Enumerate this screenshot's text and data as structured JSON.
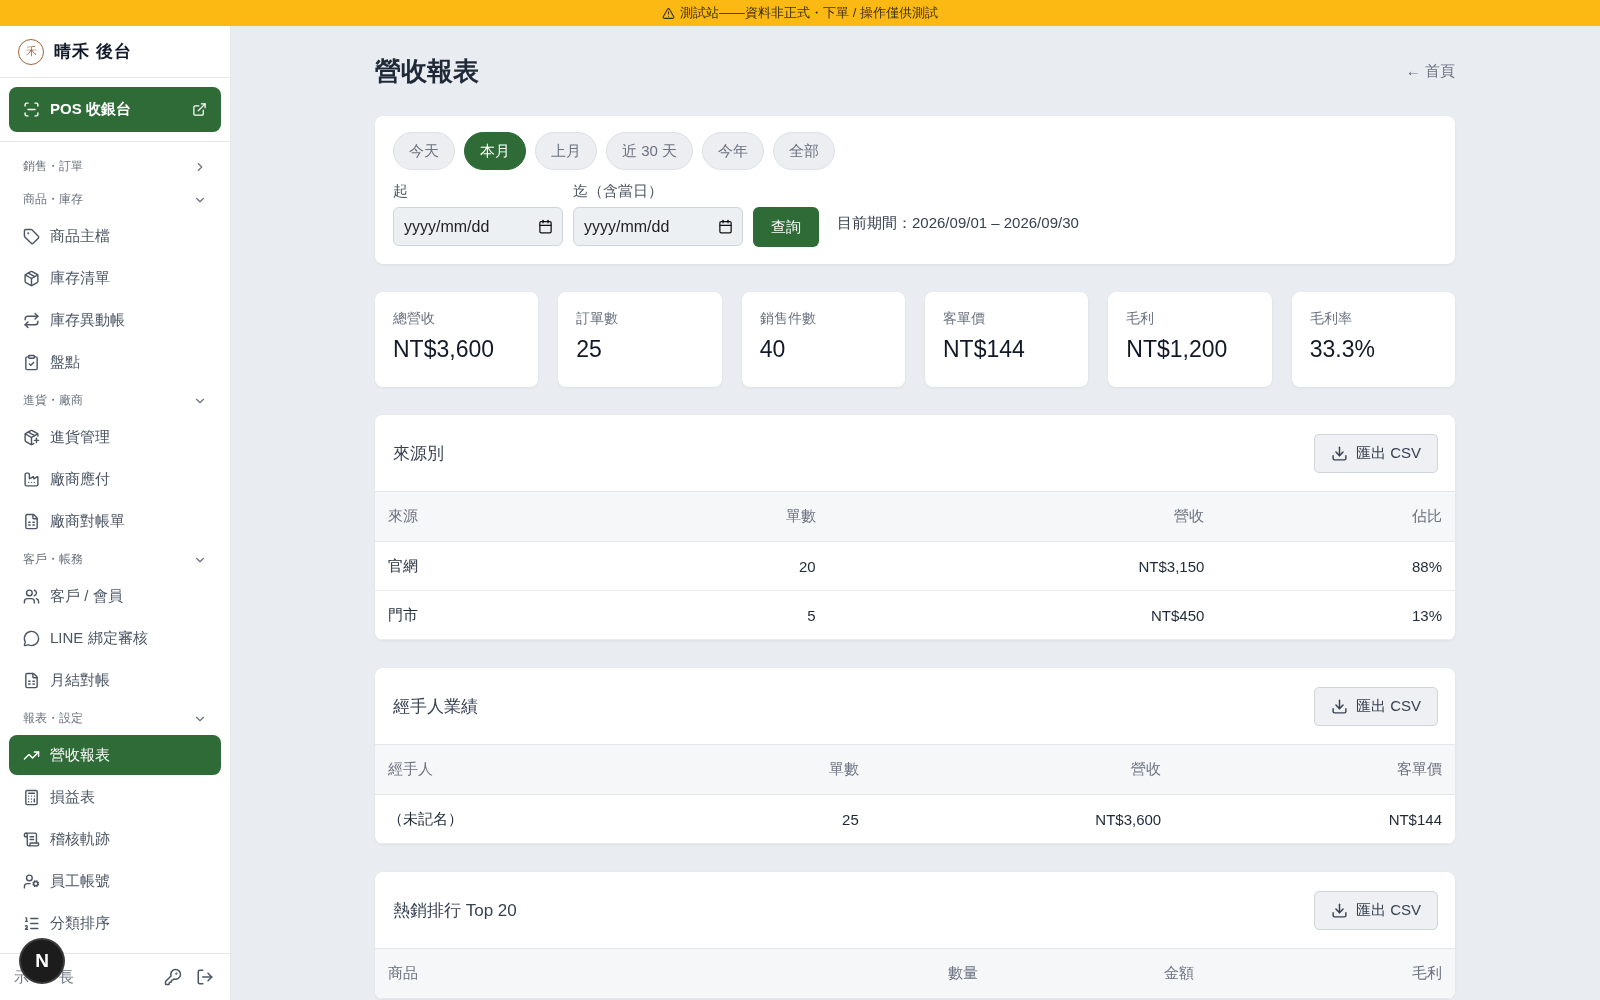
{
  "banner": {
    "text": "測試站——資料非正式・下單 / 操作僅供測試"
  },
  "sidebar": {
    "brand": "晴禾 後台",
    "brand_mark": "禾",
    "pos_button": "POS 收銀台",
    "groups": [
      {
        "label": "銷售・訂單",
        "expanded": false
      },
      {
        "label": "商品・庫存",
        "expanded": true,
        "items": [
          {
            "label": "商品主檔",
            "selected": false
          },
          {
            "label": "庫存清單",
            "selected": false
          },
          {
            "label": "庫存異動帳",
            "selected": false
          },
          {
            "label": "盤點",
            "selected": false
          }
        ]
      },
      {
        "label": "進貨・廠商",
        "expanded": true,
        "items": [
          {
            "label": "進貨管理",
            "selected": false
          },
          {
            "label": "廠商應付",
            "selected": false
          },
          {
            "label": "廠商對帳單",
            "selected": false
          }
        ]
      },
      {
        "label": "客戶・帳務",
        "expanded": true,
        "items": [
          {
            "label": "客戶 / 會員",
            "selected": false
          },
          {
            "label": "LINE 綁定審核",
            "selected": false
          },
          {
            "label": "月結對帳",
            "selected": false
          }
        ]
      },
      {
        "label": "報表・設定",
        "expanded": true,
        "items": [
          {
            "label": "營收報表",
            "selected": true
          },
          {
            "label": "損益表",
            "selected": false
          },
          {
            "label": "稽核軌跡",
            "selected": false
          },
          {
            "label": "員工帳號",
            "selected": false
          },
          {
            "label": "分類排序",
            "selected": false
          }
        ]
      }
    ],
    "user_visible_parts": [
      "示",
      "長"
    ],
    "dev_badge": "N"
  },
  "page": {
    "title": "營收報表",
    "back_link": "← 首頁"
  },
  "filters": {
    "presets": [
      {
        "label": "今天",
        "selected": false
      },
      {
        "label": "本月",
        "selected": true
      },
      {
        "label": "上月",
        "selected": false
      },
      {
        "label": "近 30 天",
        "selected": false
      },
      {
        "label": "今年",
        "selected": false
      },
      {
        "label": "全部",
        "selected": false
      }
    ],
    "from": {
      "label": "起",
      "placeholder": "yyyy/mm/dd"
    },
    "to": {
      "label": "迄（含當日）",
      "placeholder": "yyyy/mm/dd"
    },
    "query_button": "查詢",
    "period": "目前期間：2026/09/01 – 2026/09/30"
  },
  "kpis": [
    {
      "label": "總營收",
      "value": "NT$3,600"
    },
    {
      "label": "訂單數",
      "value": "25"
    },
    {
      "label": "銷售件數",
      "value": "40"
    },
    {
      "label": "客單價",
      "value": "NT$144"
    },
    {
      "label": "毛利",
      "value": "NT$1,200"
    },
    {
      "label": "毛利率",
      "value": "33.3%"
    }
  ],
  "tables": [
    {
      "title": "來源別",
      "export_button": "匯出 CSV",
      "columns": [
        "來源",
        "單數",
        "營收",
        "佔比"
      ],
      "rows": [
        [
          "官網",
          "20",
          "NT$3,150",
          "88%"
        ],
        [
          "門市",
          "5",
          "NT$450",
          "13%"
        ]
      ]
    },
    {
      "title": "經手人業績",
      "export_button": "匯出 CSV",
      "columns": [
        "經手人",
        "單數",
        "營收",
        "客單價"
      ],
      "rows": [
        [
          "（未記名）",
          "25",
          "NT$3,600",
          "NT$144"
        ]
      ]
    },
    {
      "title": "熱銷排行 Top 20",
      "export_button": "匯出 CSV",
      "columns": [
        "商品",
        "數量",
        "金額",
        "毛利"
      ]
    }
  ]
}
